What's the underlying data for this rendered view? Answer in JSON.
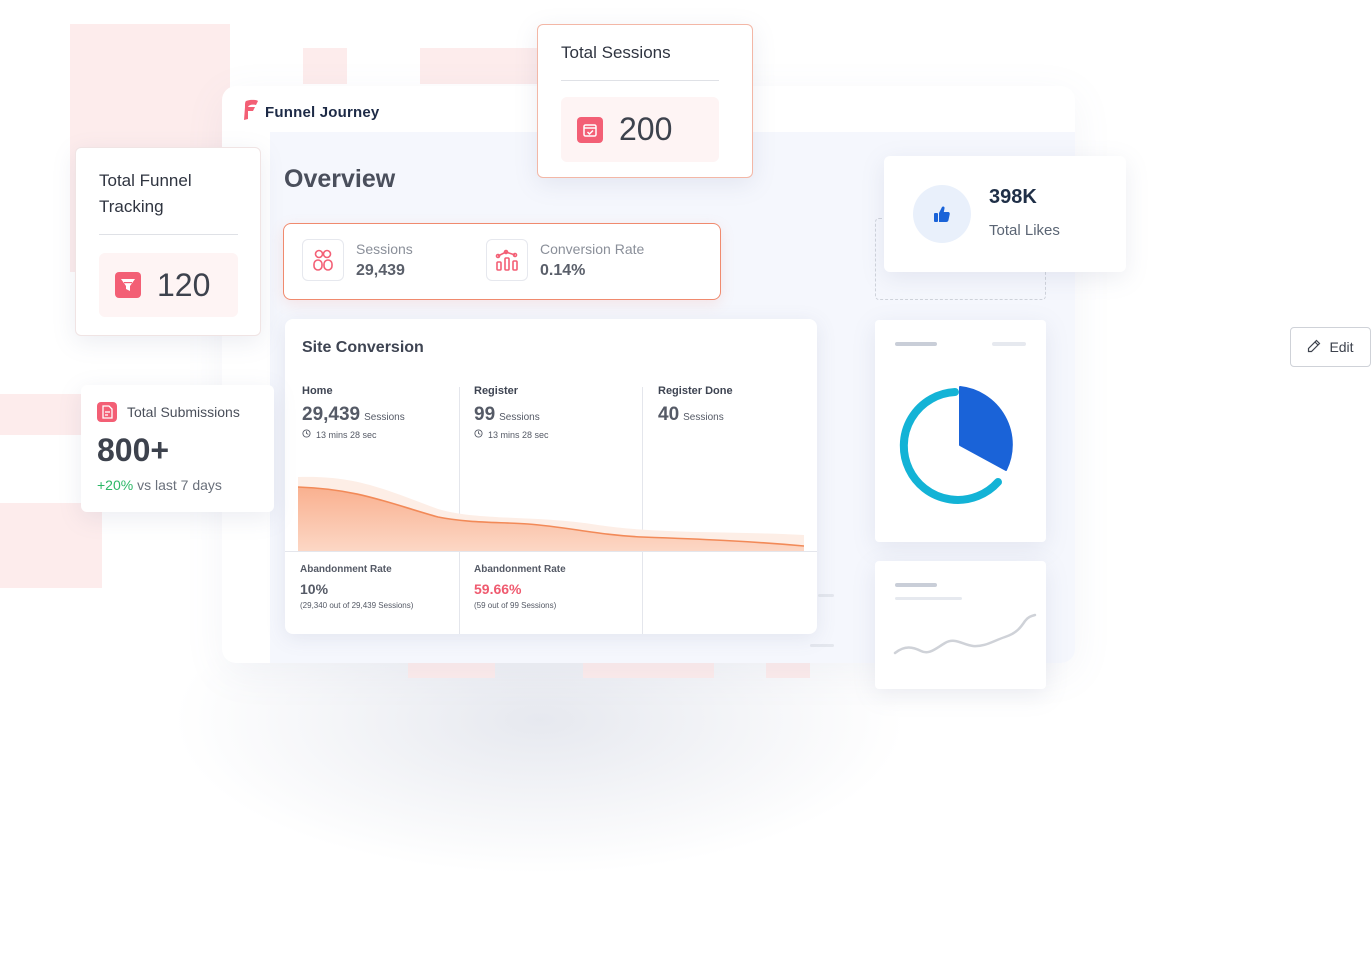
{
  "brand": {
    "name": "Funnel Journey",
    "accent_color": "#f35f75"
  },
  "overview": {
    "title": "Overview"
  },
  "stats_bar": {
    "sessions": {
      "label": "Sessions",
      "value": "29,439",
      "icon": "users-icon"
    },
    "conversion": {
      "label": "Conversion Rate",
      "value": "0.14%",
      "icon": "bar-chart-icon"
    }
  },
  "site_conversion": {
    "title": "Site Conversion",
    "steps": [
      {
        "name": "Home",
        "value": "29,439",
        "unit": "Sessions",
        "time": "13 mins 28 sec"
      },
      {
        "name": "Register",
        "value": "99",
        "unit": "Sessions",
        "time": "13 mins 28 sec"
      },
      {
        "name": "Register Done",
        "value": "40",
        "unit": "Sessions"
      }
    ],
    "abandonment": [
      {
        "label": "Abandonment Rate",
        "value": "10%",
        "note": "(29,340 out of 29,439 Sessions)"
      },
      {
        "label": "Abandonment Rate",
        "value": "59.66%",
        "note": "(59 out of 99 Sessions)"
      }
    ]
  },
  "total_funnel": {
    "title": "Total Funnel Tracking",
    "value": "120",
    "icon": "funnel-icon"
  },
  "total_sessions": {
    "title": "Total Sessions",
    "value": "200",
    "icon": "calendar-icon"
  },
  "total_submissions": {
    "title": "Total Submissions",
    "value": "800+",
    "change": "+20%",
    "change_suffix": " vs last 7 days",
    "icon": "form-icon"
  },
  "total_likes": {
    "value": "398K",
    "label": "Total Likes",
    "icon": "thumbs-up-icon"
  },
  "edit_button": {
    "label": "Edit",
    "icon": "pencil-icon"
  },
  "colors": {
    "coral": "#f08a6e",
    "positive": "#2db867",
    "negative": "#ef5a6f",
    "pie_dark": "#1a63d8",
    "pie_ring": "#13b3d6"
  }
}
